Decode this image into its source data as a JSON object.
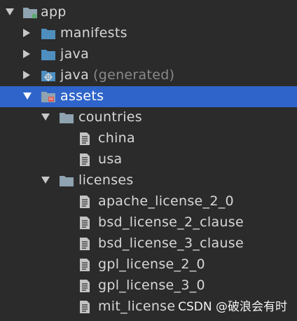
{
  "project_tree": {
    "root": {
      "label": "app",
      "icon": "module-folder-icon",
      "expanded": true
    },
    "manifests": {
      "label": "manifests",
      "icon": "folder-icon",
      "expanded": false
    },
    "java": {
      "label": "java",
      "icon": "folder-icon",
      "expanded": false
    },
    "java_generated": {
      "label": "java",
      "note": "(generated)",
      "icon": "generated-folder-icon",
      "expanded": false
    },
    "assets": {
      "label": "assets",
      "icon": "assets-folder-icon",
      "expanded": true,
      "selected": true
    },
    "countries": {
      "label": "countries",
      "icon": "folder-icon",
      "expanded": true,
      "files": [
        "china",
        "usa"
      ]
    },
    "licenses": {
      "label": "licenses",
      "icon": "folder-icon",
      "expanded": true,
      "files": [
        "apache_license_2_0",
        "bsd_license_2_clause",
        "bsd_license_3_clause",
        "gpl_license_2_0",
        "gpl_license_3_0",
        "mit_license"
      ]
    }
  },
  "watermark": "CSDN @破浪会有时",
  "colors": {
    "background": "#2b2b2b",
    "selection": "#2f65ca",
    "folder": "#8fa3b1",
    "java_folder": "#4e8fbf",
    "text": "#d7d7d7",
    "muted": "#8a8a8a"
  }
}
